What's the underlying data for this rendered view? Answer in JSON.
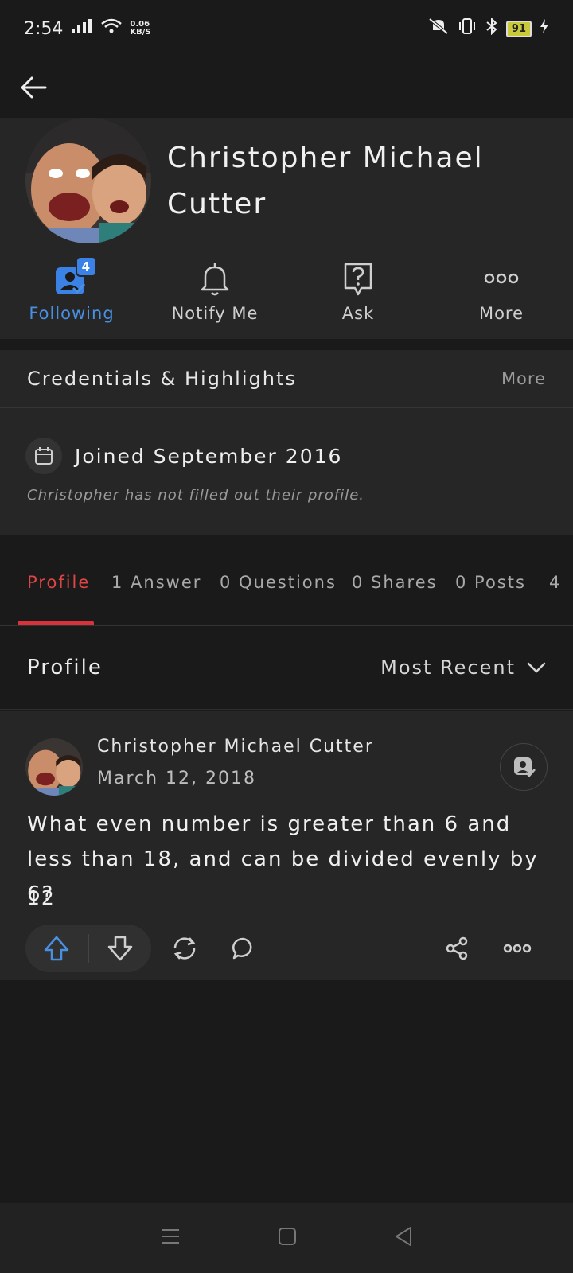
{
  "status_bar": {
    "time": "2:54",
    "net_speed_value": "0.06",
    "net_speed_unit": "KB/S",
    "battery": "91"
  },
  "profile": {
    "name": "Christopher Michael Cutter",
    "following_label": "Following",
    "following_count": "4",
    "notify_label": "Notify Me",
    "ask_label": "Ask",
    "more_label": "More"
  },
  "credentials": {
    "title": "Credentials & Highlights",
    "more_label": "More",
    "joined": "Joined September 2016",
    "note": "Christopher has not filled out their profile."
  },
  "tabs": [
    {
      "label": "Profile",
      "active": true
    },
    {
      "label": "1 Answer"
    },
    {
      "label": "0 Questions"
    },
    {
      "label": "0 Shares"
    },
    {
      "label": "0 Posts"
    },
    {
      "label": "4"
    }
  ],
  "filter": {
    "label": "Profile",
    "sort": "Most Recent"
  },
  "post": {
    "author": "Christopher Michael Cutter",
    "date": "March 12, 2018",
    "question": "What even number is greater than 6 and less than 18, and can be divided evenly by 6?",
    "answer": "12"
  },
  "colors": {
    "accent_blue": "#4a90e2",
    "active_tab_red": "#e04545",
    "background": "#1a1a1a",
    "card": "#262626"
  }
}
